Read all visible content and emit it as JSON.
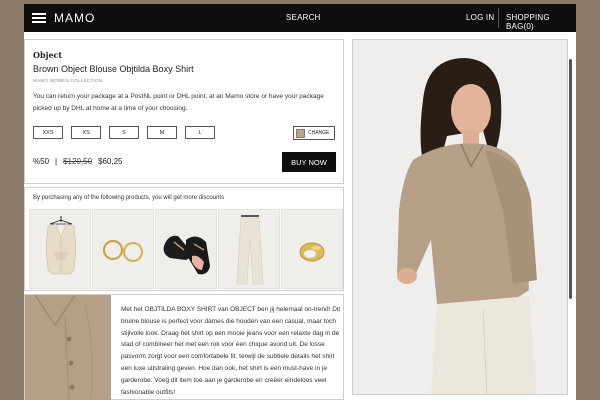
{
  "topbar": {
    "logo": "MAMO",
    "search_label": "SEARCH",
    "login_label": "LOG IN",
    "bag_label": "SHOPPING BAG(0)"
  },
  "product": {
    "brand": "Object",
    "title": "Brown Object Blouse Objtilda Boxy Shirt",
    "collection": "MAMO WOMEN COLLECTION",
    "returns_text": "You can return your package at a PostNL point or DHL point, at an Mamo store or have your package picked up by DHL at home at a time of your choosing.",
    "sizes": [
      "XXS",
      "XS",
      "S",
      "M",
      "L"
    ],
    "change_label": "CHANGE",
    "discount": "%50",
    "price_separator": "|",
    "old_price": "$120,50",
    "new_price": "$60,25",
    "buy_label": "BUY NOW"
  },
  "bundle": {
    "heading": "By purchasing any of the following products, you will get more discounts"
  },
  "description": {
    "text": "Met het OBJTILDA BOXY SHIRT van OBJECT ben jij helemaal on-trend! Dit bruine blouse is perfect voor dames die houden van een casual, maar toch stijlvolle look. Draag het shirt op een mooie jeans voor een relaxte dag in de stad of combineer het met een rok voor een chique avond uit. De losse pasvorm zorgt voor een comfortabele fit, terwijl de subtiele details het shirt een luxe uitstraling geven. Hoe dan ook, het shirt is een must-have in je garderobe. Voeg dit item toe aan je garderobe en creëer eindeloos veel fashionable outfits!"
  },
  "colors": {
    "topbar": "#0e0e0e",
    "swatch": "#b8a48c",
    "shirt": "#b59f86"
  },
  "icons": [
    "hamburger-icon"
  ]
}
